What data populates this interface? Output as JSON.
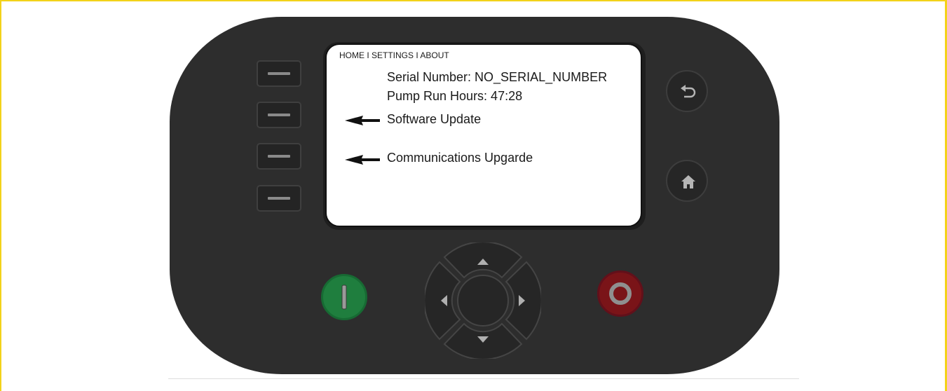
{
  "screen": {
    "breadcrumb": "HOME I SETTINGS I ABOUT",
    "serial_number": "Serial Number: NO_SERIAL_NUMBER",
    "pump_run_hours": "Pump Run Hours: 47:28",
    "software_update": "Software Update",
    "communications_upgrade": "Communications Upgarde"
  },
  "icons": {
    "back": "back-arrow-icon",
    "home": "home-icon",
    "start": "power-on-icon",
    "stop": "power-off-icon",
    "up": "triangle-up-icon",
    "down": "triangle-down-icon",
    "left": "triangle-left-icon",
    "right": "triangle-right-icon",
    "soft_key": "dash-icon",
    "pointer": "left-arrow-icon"
  },
  "colors": {
    "frame_border": "#f3d21a",
    "device_body": "#2d2d2d",
    "start_button": "#1f7e3e",
    "stop_button": "#7a1418",
    "screen_bg": "#ffffff"
  }
}
